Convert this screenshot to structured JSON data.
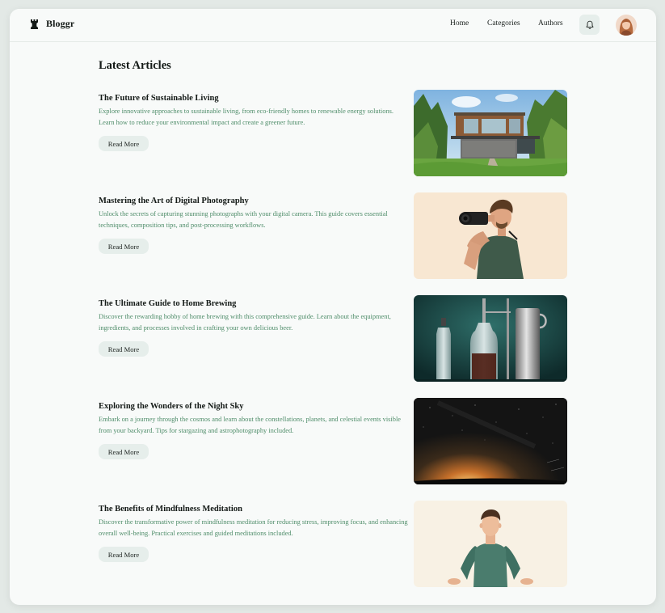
{
  "header": {
    "brand": "Bloggr",
    "nav": [
      "Home",
      "Categories",
      "Authors"
    ]
  },
  "icons": {
    "logo": "chess-rook-logo",
    "notifications": "bell-icon",
    "avatar": "user-avatar"
  },
  "main": {
    "section_title": "Latest Articles",
    "articles": [
      {
        "title": "The Future of Sustainable Living",
        "description": "Explore innovative approaches to sustainable living, from eco-friendly homes to renewable energy solutions. Learn how to reduce your environmental impact and create a greener future.",
        "button": "Read More",
        "image": "modern-house-in-forest"
      },
      {
        "title": "Mastering the Art of Digital Photography",
        "description": "Unlock the secrets of capturing stunning photographs with your digital camera. This guide covers essential techniques, composition tips, and post-processing workflows.",
        "button": "Read More",
        "image": "photographer-with-camera"
      },
      {
        "title": "The Ultimate Guide to Home Brewing",
        "description": "Discover the rewarding hobby of home brewing with this comprehensive guide. Learn about the equipment, ingredients, and processes involved in crafting your own delicious beer.",
        "button": "Read More",
        "image": "brewing-equipment"
      },
      {
        "title": "Exploring the Wonders of the Night Sky",
        "description": "Embark on a journey through the cosmos and learn about the constellations, planets, and celestial events visible from your backyard. Tips for stargazing and astrophotography included.",
        "button": "Read More",
        "image": "night-sky-horizon"
      },
      {
        "title": "The Benefits of Mindfulness Meditation",
        "description": "Discover the transformative power of mindfulness meditation for reducing stress, improving focus, and enhancing overall well-being. Practical exercises and guided meditations included.",
        "button": "Read More",
        "image": "meditating-man"
      }
    ]
  },
  "colors": {
    "page_bg": "#e3e9e6",
    "card_bg": "#f8faf9",
    "accent_text": "#4f8d6a",
    "button_bg": "#e6eeeb"
  }
}
